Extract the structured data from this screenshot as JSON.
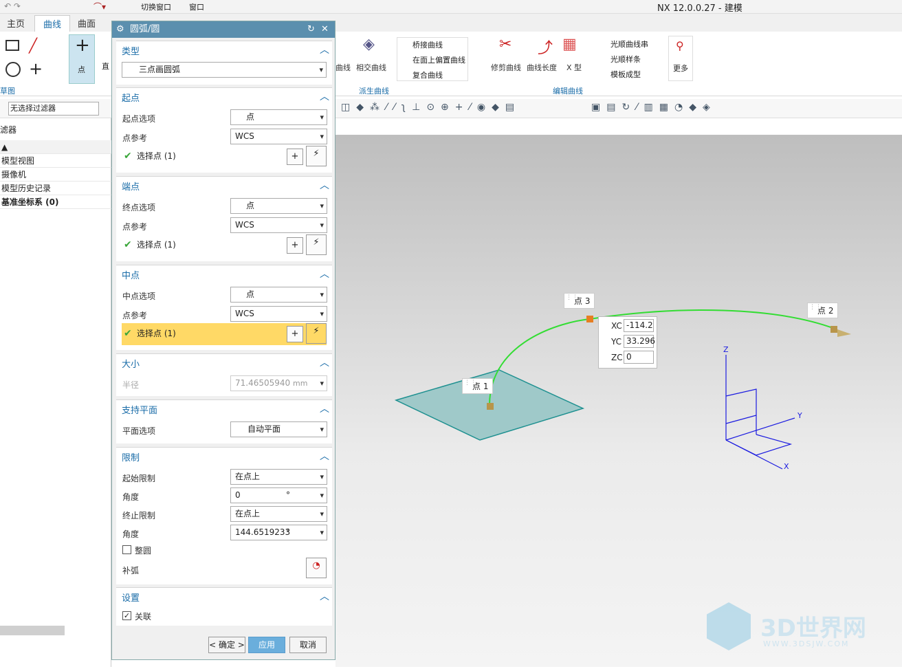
{
  "app": {
    "title": "NX 12.0.0.27 - 建模",
    "switch_window": "切换窗口",
    "window_menu": "窗口"
  },
  "tabs": [
    "主页",
    "曲线",
    "曲面"
  ],
  "ribbon": {
    "point_label": "点",
    "line_label": "直",
    "group_sketch": "草图",
    "derived": {
      "bridge": "桥接曲线",
      "offset_face": "在面上偏置曲线",
      "composite": "复合曲线",
      "iso": "曲线",
      "intersect": "相交曲线",
      "group": "派生曲线"
    },
    "edit": {
      "trim": "修剪曲线",
      "length": "曲线长度",
      "xform": "X 型",
      "smooth_string": "光顺曲线串",
      "smooth_spline": "光顺样条",
      "template": "模板成型",
      "group": "编辑曲线"
    },
    "more": "更多"
  },
  "filter": {
    "value": "无选择过滤器"
  },
  "nav": {
    "header": "滤器",
    "rows": [
      "模型视图",
      "摄像机",
      "模型历史记录",
      "基准坐标系 (0)"
    ]
  },
  "dialog": {
    "title": "圆弧/圆",
    "type": {
      "header": "类型",
      "value": "三点画圆弧"
    },
    "start": {
      "header": "起点",
      "opt_label": "起点选项",
      "opt_value": "点",
      "ref_label": "点参考",
      "ref_value": "WCS",
      "select": "选择点 (1)"
    },
    "end": {
      "header": "端点",
      "opt_label": "终点选项",
      "opt_value": "点",
      "ref_label": "点参考",
      "ref_value": "WCS",
      "select": "选择点 (1)"
    },
    "mid": {
      "header": "中点",
      "opt_label": "中点选项",
      "opt_value": "点",
      "ref_label": "点参考",
      "ref_value": "WCS",
      "select": "选择点 (1)"
    },
    "size": {
      "header": "大小",
      "radius_label": "半径",
      "radius_value": "71.46505940",
      "radius_unit": "mm"
    },
    "plane": {
      "header": "支持平面",
      "label": "平面选项",
      "value": "自动平面"
    },
    "limits": {
      "header": "限制",
      "start_label": "起始限制",
      "start_value": "在点上",
      "angle1_label": "角度",
      "angle1_value": "0",
      "angle_unit": "°",
      "end_label": "终止限制",
      "end_value": "在点上",
      "angle2_label": "角度",
      "angle2_value": "144.6519233",
      "full_circle": "整圆",
      "complement": "补弧"
    },
    "settings": {
      "header": "设置",
      "assoc": "关联"
    },
    "ok": "< 确定 >",
    "apply": "应用",
    "cancel": "取消"
  },
  "viewport": {
    "p1": "点 1",
    "p2": "点 2",
    "p3": "点 3",
    "xc_label": "XC",
    "xc": "-114.2",
    "yc_label": "YC",
    "yc": "33.296",
    "zc_label": "ZC",
    "zc": "0",
    "axis_x": "X",
    "axis_y": "Y",
    "axis_z": "Z"
  },
  "watermark": {
    "main": "3D世界网",
    "sub": "WWW.3DSJW.COM"
  },
  "colors": {
    "accent": "#1a6ca8",
    "title": "#5b8fae",
    "highlight": "#ffd966",
    "arc": "#33dd33",
    "plane": "#9fc9c9"
  }
}
